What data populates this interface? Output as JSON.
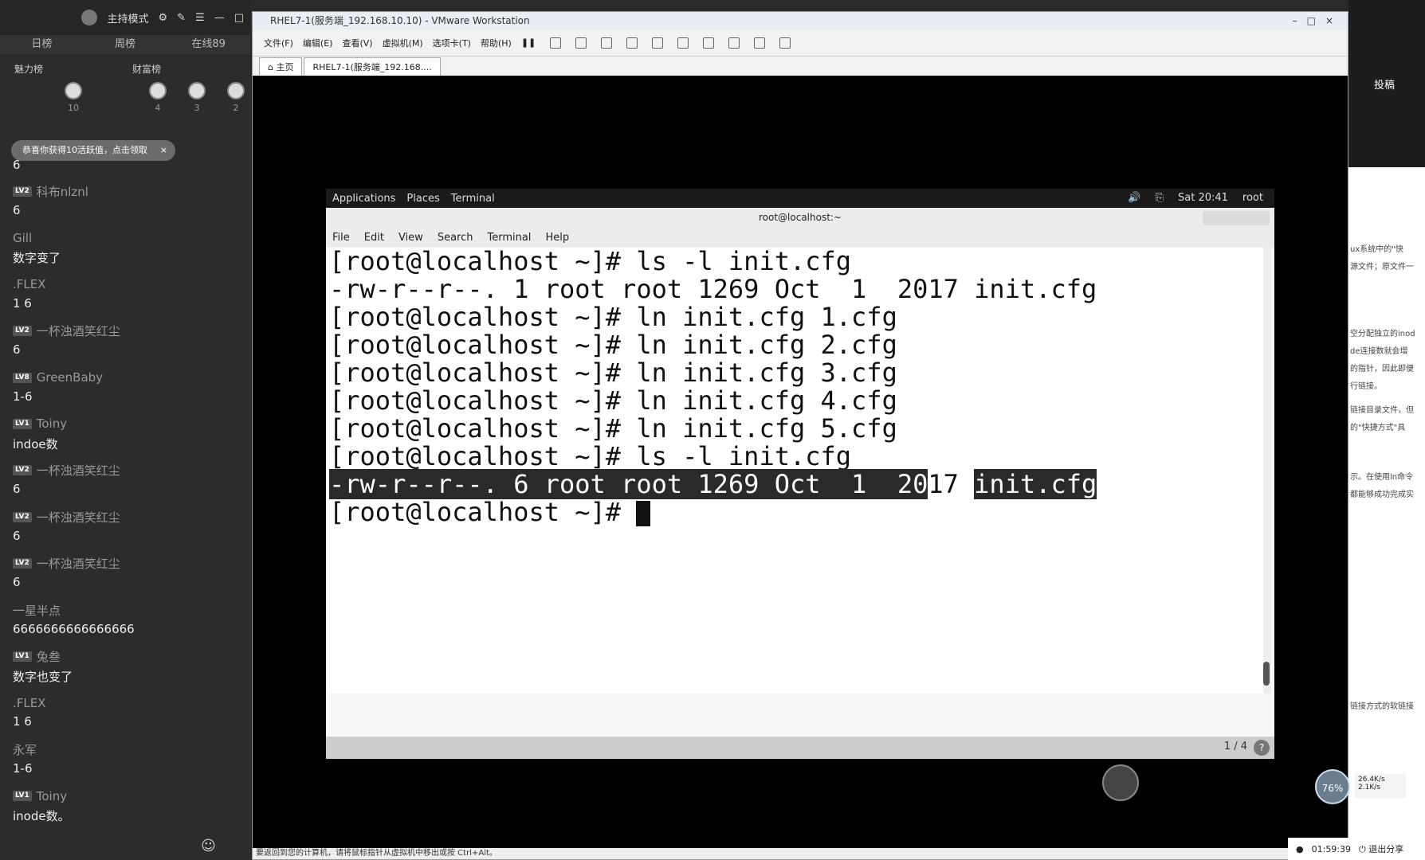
{
  "live": {
    "mode_label": "主持模式",
    "tabs": [
      "日榜",
      "周榜",
      "在线89"
    ],
    "rank_headers": [
      "魅力榜",
      "财富榜"
    ],
    "ranks": [
      {
        "value": "10"
      },
      {
        "value": "4"
      },
      {
        "value": "3"
      },
      {
        "value": "2"
      }
    ],
    "congrats": "恭喜你获得10活跃值，点击领取",
    "congrats_close": "×",
    "messages": [
      {
        "lv": "LV2",
        "user": "科布nlznl",
        "text": "6"
      },
      {
        "lv": "",
        "user": "Gill",
        "text": "数字变了"
      },
      {
        "lv": "",
        "user": ".FLEX",
        "text": "1 6"
      },
      {
        "lv": "LV2",
        "user": "一杯浊酒笑红尘",
        "text": "6"
      },
      {
        "lv": "LV8",
        "user": "GreenBaby",
        "text": "1-6"
      },
      {
        "lv": "LV1",
        "user": "Toiny",
        "text": "indoe数"
      },
      {
        "lv": "LV2",
        "user": "一杯浊酒笑红尘",
        "text": "6"
      },
      {
        "lv": "LV2",
        "user": "一杯浊酒笑红尘",
        "text": "6"
      },
      {
        "lv": "LV2",
        "user": "一杯浊酒笑红尘",
        "text": "6"
      },
      {
        "lv": "",
        "user": "一星半点",
        "text": "6666666666666666"
      },
      {
        "lv": "LV1",
        "user": "兔叁",
        "text": "数字也变了"
      },
      {
        "lv": "",
        "user": ".FLEX",
        "text": "1   6"
      },
      {
        "lv": "",
        "user": "永军",
        "text": "1-6"
      },
      {
        "lv": "LV1",
        "user": "Toiny",
        "text": "inode数。"
      }
    ],
    "first_text": "6"
  },
  "vm": {
    "title": "RHEL7-1(服务端_192.168.10.10) - VMware Workstation",
    "menu": [
      "文件(F)",
      "编辑(E)",
      "查看(V)",
      "虚拟机(M)",
      "选项卡(T)",
      "帮助(H)"
    ],
    "tabs": [
      "主页",
      "RHEL7-1(服务端_192.168...."
    ],
    "status": "要返回到您的计算机，请将鼠标指针从虚拟机中移出或按 Ctrl+Alt。"
  },
  "gnome": {
    "applications": "Applications",
    "places": "Places",
    "terminal_tab": "Terminal",
    "clock": "Sat 20:41",
    "user": "root"
  },
  "terminal": {
    "title": "root@localhost:~",
    "menu": [
      "File",
      "Edit",
      "View",
      "Search",
      "Terminal",
      "Help"
    ],
    "lines": [
      "[root@localhost ~]# ls -l init.cfg",
      "-rw-r--r--. 1 root root 1269 Oct  1  2017 init.cfg",
      "[root@localhost ~]# ln init.cfg 1.cfg",
      "[root@localhost ~]# ln init.cfg 2.cfg",
      "[root@localhost ~]# ln init.cfg 3.cfg",
      "[root@localhost ~]# ln init.cfg 4.cfg",
      "[root@localhost ~]# ln init.cfg 5.cfg",
      "[root@localhost ~]# ls -l init.cfg"
    ],
    "selected_a": "-rw-r--r--. 6 root root 1269 Oct  1  20",
    "selected_b": "17 ",
    "selected_c": "init.cfg",
    "prompt": "[root@localhost ~]# ",
    "pager": "1 / 4",
    "help": "?"
  },
  "right": {
    "tab": "投稿",
    "snippets": [
      "ux系统中的\"快",
      "源文件；原文件一",
      "空分配独立的inod",
      "de连接数就会增",
      "的指针，因此即便",
      "行链接。",
      "链接目录文件，但",
      "的\"快捷方式\"具",
      "示。在使用ln命令",
      "都能够成功完成实",
      "链接方式的软链接"
    ],
    "cpu": "76%",
    "net_up": "26.4K/s",
    "net_down": "2.1K/s",
    "time": "01:59:39",
    "exit": "退出分享"
  }
}
